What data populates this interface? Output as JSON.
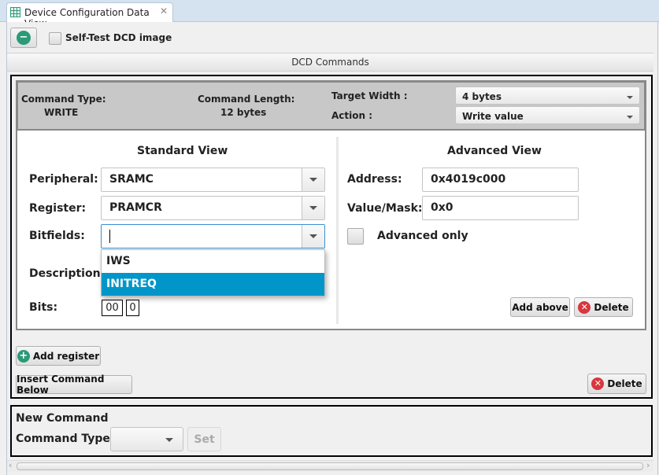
{
  "tab": {
    "title": "Device Configuration Data View"
  },
  "toolbar": {
    "self_test_label": "Self-Test DCD image",
    "self_test_checked": false
  },
  "section_title": "DCD Commands",
  "command": {
    "type_label": "Command Type:",
    "type_value": "WRITE",
    "length_label": "Command Length:",
    "length_value": "12 bytes",
    "target_width_label": "Target Width :",
    "target_width_value": "4 bytes",
    "action_label": "Action :",
    "action_value": "Write value"
  },
  "standard": {
    "title": "Standard View",
    "peripheral_label": "Peripheral:",
    "peripheral_value": "SRAMC",
    "register_label": "Register:",
    "register_value": "PRAMCR",
    "bitfields_label": "Bitfields:",
    "bitfields_value": "",
    "bitfield_options": [
      "IWS",
      "INITREQ"
    ],
    "bitfield_selected": "INITREQ",
    "description_label": "Description:",
    "bits_label": "Bits:",
    "bits": [
      "00",
      "0"
    ]
  },
  "advanced": {
    "title": "Advanced View",
    "address_label": "Address:",
    "address_value": "0x4019c000",
    "value_label": "Value/Mask:",
    "value_value": "0x0",
    "advanced_only_label": "Advanced only",
    "advanced_only_checked": false,
    "add_above": "Add above",
    "delete": "Delete"
  },
  "actions": {
    "add_register": "Add register",
    "insert_below": "Insert Command Below",
    "delete": "Delete"
  },
  "new_command": {
    "title": "New Command",
    "type_label": "Command Type:",
    "type_value": "",
    "set": "Set"
  },
  "colors": {
    "accent": "#0096c9",
    "green_icon": "#2a9a78",
    "red_icon": "#d9363e"
  }
}
